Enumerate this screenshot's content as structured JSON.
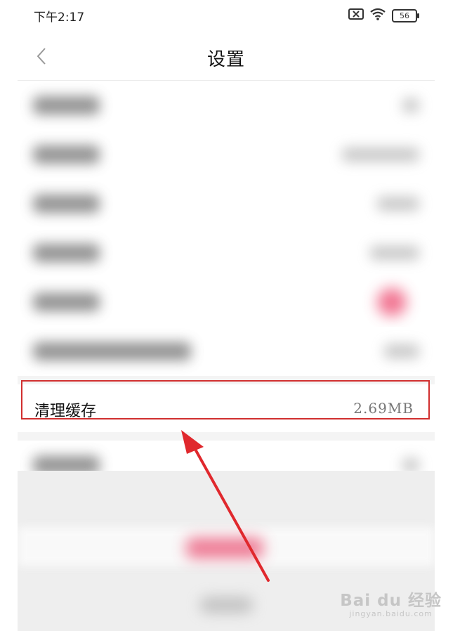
{
  "status_bar": {
    "time": "下午2:17",
    "battery": "56"
  },
  "navbar": {
    "title": "设置"
  },
  "cache_row": {
    "label": "清理缓存",
    "value": "2.69MB"
  },
  "watermark": {
    "brand": "Bai du 经验",
    "url": "jingyan.baidu.com"
  },
  "colors": {
    "highlight": "#d12f2f",
    "arrow": "#e0282d",
    "accent_blurred": "#ef5d7f"
  }
}
